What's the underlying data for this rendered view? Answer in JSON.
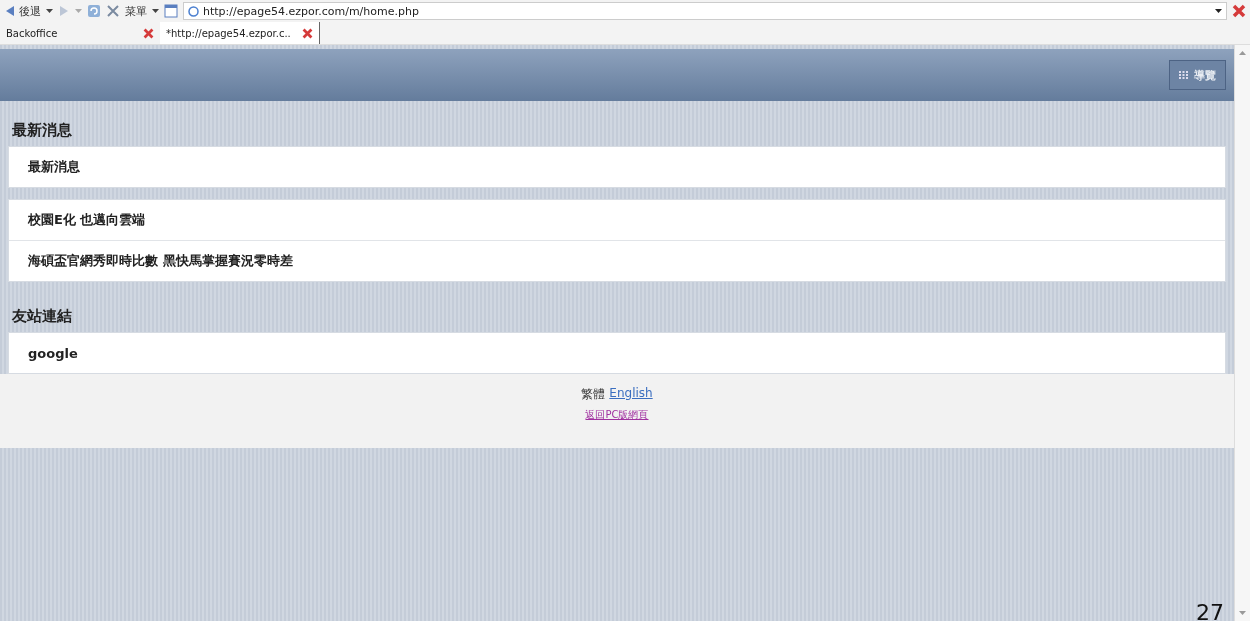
{
  "browser": {
    "back_label": "後退",
    "menu_label": "菜單",
    "address": "http://epage54.ezpor.com/m/home.php"
  },
  "tabs": [
    {
      "label": "Backoffice",
      "selected": false
    },
    {
      "label": "*http://epage54.ezpor.c..",
      "selected": true
    }
  ],
  "header": {
    "nav_button": "導覽"
  },
  "sections": [
    {
      "title": "最新消息",
      "groups": [
        [
          "最新消息"
        ],
        [
          "校園E化 也邁向雲端",
          "海碩盃官網秀即時比數 黑快馬掌握賽況零時差"
        ]
      ]
    },
    {
      "title": "友站連結",
      "groups": [
        [
          "google"
        ]
      ]
    }
  ],
  "footer": {
    "language": "繁體",
    "language_link": "English",
    "pc_link": "返回PC版網頁"
  },
  "page_number": "27"
}
